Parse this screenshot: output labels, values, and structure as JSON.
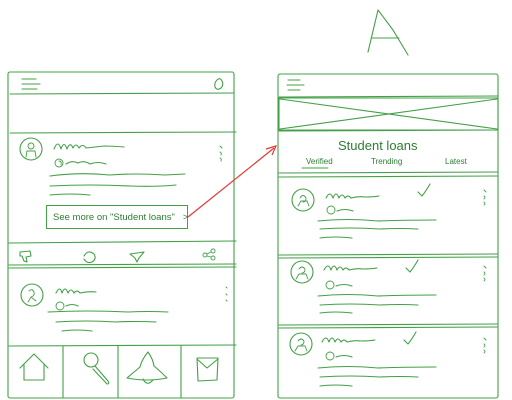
{
  "screen_label": "A",
  "post": {
    "cta_label": "See more on \"Student loans\"",
    "cta_chevron": ">"
  },
  "feed": {
    "title": "Student loans",
    "tabs": [
      {
        "label": "Verified",
        "active": true
      },
      {
        "label": "Trending",
        "active": false
      },
      {
        "label": "Latest",
        "active": false
      }
    ]
  },
  "icons": {
    "left_header": [
      "menu-icon",
      "profile-icon"
    ],
    "left_actions": [
      "thumbs-down-icon",
      "refresh-icon",
      "heart-icon",
      "share-icon"
    ],
    "bottom_nav": [
      "home-icon",
      "search-icon",
      "notifications-icon",
      "messages-icon"
    ],
    "right_header": [
      "menu-icon"
    ],
    "right_banner": "image-placeholder"
  },
  "colors": {
    "sketch": "#43a047",
    "connector": "#e53935"
  }
}
